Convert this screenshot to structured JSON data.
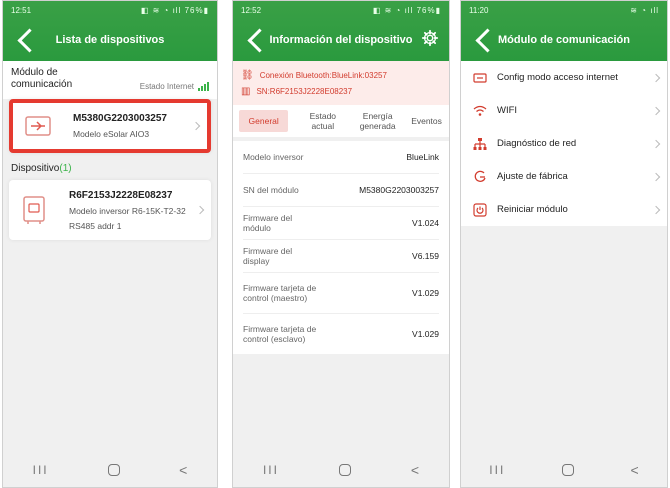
{
  "phone1": {
    "status": {
      "time": "12:51",
      "icons": "◧ ≋ ◔ ıll 76%▮"
    },
    "title": "Lista de dispositivos",
    "module_label": "Módulo de comunicación",
    "internet_label": "Estado Internet",
    "module_card": {
      "serial": "M5380G2203003257",
      "model": "Modelo  eSolar AIO3"
    },
    "devices_label": "Dispositivo",
    "devices_count": "(1)",
    "device_card": {
      "serial": "R6F2153J2228E08237",
      "model": "Modelo inversor  R6-15K-T2-32",
      "addr": "RS485 addr  1"
    }
  },
  "phone2": {
    "status": {
      "time": "12:52",
      "icons": "◧ ≋ ◔ ıll 76%▮"
    },
    "title": "Información del dispositivo",
    "bt_connection": "Conexión Bluetooth:BlueLink:03257",
    "sn": "SN:R6F2153J2228E08237",
    "tabs": [
      {
        "label": "General"
      },
      {
        "label": "Estado actual"
      },
      {
        "label": "Energía generada"
      },
      {
        "label": "Eventos"
      }
    ],
    "rows": [
      {
        "label": "Modelo inversor",
        "value": "BlueLink"
      },
      {
        "label": "SN del módulo",
        "value": "M5380G2203003257"
      },
      {
        "label": "Firmware del módulo",
        "value": "V1.024"
      },
      {
        "label": "Firmware del display",
        "value": "V6.159"
      },
      {
        "label": "Firmware tarjeta de control (maestro)",
        "value": "V1.029"
      },
      {
        "label": "Firmware tarjeta de control (esclavo)",
        "value": "V1.029"
      }
    ]
  },
  "phone3": {
    "status": {
      "time": "11:20",
      "icons": "≋ ◔ ıll"
    },
    "title": "Módulo de comunicación",
    "items": [
      {
        "label": "Config modo acceso internet",
        "icon": "network-config-icon"
      },
      {
        "label": "WIFI",
        "icon": "wifi-icon"
      },
      {
        "label": "Diagnóstico de red",
        "icon": "network-tree-icon"
      },
      {
        "label": "Ajuste de fábrica",
        "icon": "factory-reset-icon"
      },
      {
        "label": "Reiniciar módulo",
        "icon": "power-icon"
      }
    ]
  },
  "nav": {
    "recent": "III",
    "back": "<"
  },
  "colors": {
    "brand_green": "#2a9a3e",
    "alert_red": "#e53a30",
    "accent_red": "#d23c2e"
  }
}
